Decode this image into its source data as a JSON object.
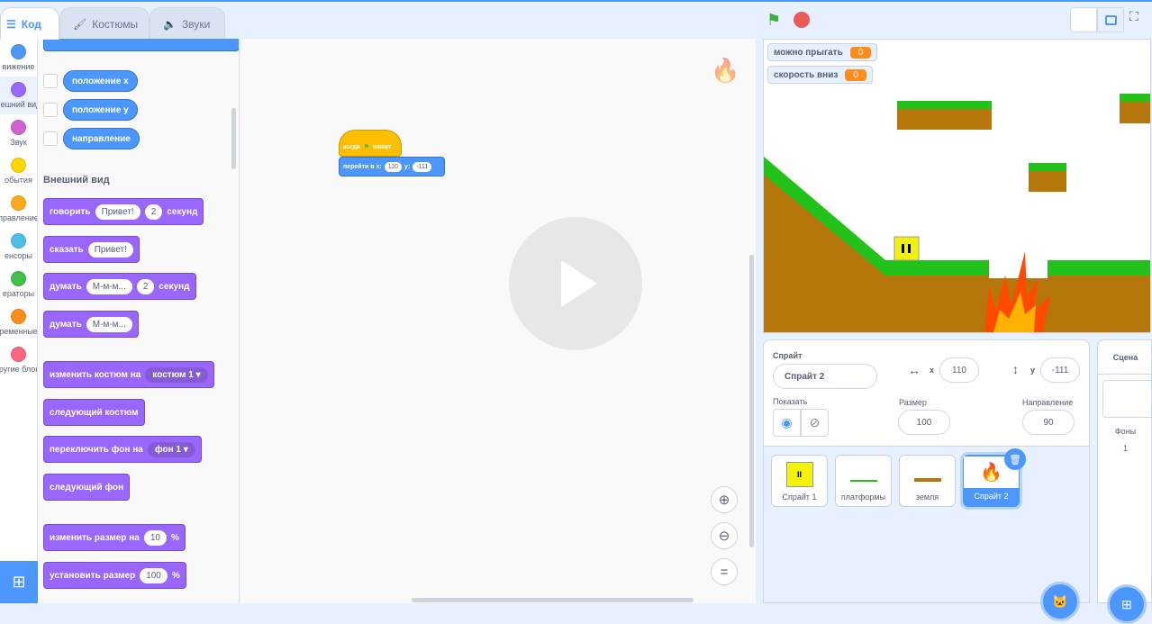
{
  "tabs": [
    {
      "label": "Код"
    },
    {
      "label": "Костюмы"
    },
    {
      "label": "Звуки"
    }
  ],
  "categories": [
    {
      "label": "вижение",
      "color": "#4c97ff"
    },
    {
      "label": "нешний вид",
      "color": "#9966ff"
    },
    {
      "label": "Звук",
      "color": "#cf63cf"
    },
    {
      "label": "обытия",
      "color": "#ffd500"
    },
    {
      "label": "правление",
      "color": "#ffab19"
    },
    {
      "label": "енсоры",
      "color": "#4cbfe6"
    },
    {
      "label": "ераторы",
      "color": "#40bf4a"
    },
    {
      "label": "ременные",
      "color": "#ff8c1a"
    },
    {
      "label": "Другие блоки",
      "color": "#ff6680"
    }
  ],
  "palette": {
    "reporters": [
      "положение x",
      "положение y",
      "направление"
    ],
    "heading": "Внешний вид",
    "say_secs": {
      "a": "говорить",
      "b": "Привет!",
      "c": "2",
      "d": "секунд"
    },
    "say": {
      "a": "сказать",
      "b": "Привет!"
    },
    "think_secs": {
      "a": "думать",
      "b": "М-м-м...",
      "c": "2",
      "d": "секунд"
    },
    "think": {
      "a": "думать",
      "b": "М-м-м..."
    },
    "switch_costume": {
      "a": "изменить костюм на",
      "b": "костюм 1"
    },
    "next_costume": "следующий костюм",
    "switch_backdrop": {
      "a": "переключить фон на",
      "b": "фон 1"
    },
    "next_backdrop": "следующий фон",
    "change_size": {
      "a": "изменить размер на",
      "b": "10",
      "c": "%"
    },
    "set_size": {
      "a": "установить размер",
      "b": "100",
      "c": "%"
    }
  },
  "script": {
    "hat_a": "когда",
    "hat_b": "нажат",
    "goto_a": "перейти в x:",
    "x": "110",
    "goto_b": "y:",
    "y": "-111"
  },
  "monitors": [
    {
      "label": "можно прыгать",
      "value": "0"
    },
    {
      "label": "скорость вниз",
      "value": "0"
    }
  ],
  "sprite_info": {
    "sprite_label": "Спрайт",
    "name": "Спрайт 2",
    "x_label": "x",
    "x": "110",
    "y_label": "y",
    "y": "-111",
    "show_label": "Показать",
    "size_label": "Размер",
    "size": "100",
    "direction_label": "Направление",
    "direction": "90"
  },
  "sprites": [
    {
      "name": "Спрайт 1"
    },
    {
      "name": "платформы"
    },
    {
      "name": "земля"
    },
    {
      "name": "Спрайт 2"
    }
  ],
  "stage_panel": {
    "title": "Сцена",
    "backdrops_label": "Фоны",
    "backdrops_count": "1"
  }
}
